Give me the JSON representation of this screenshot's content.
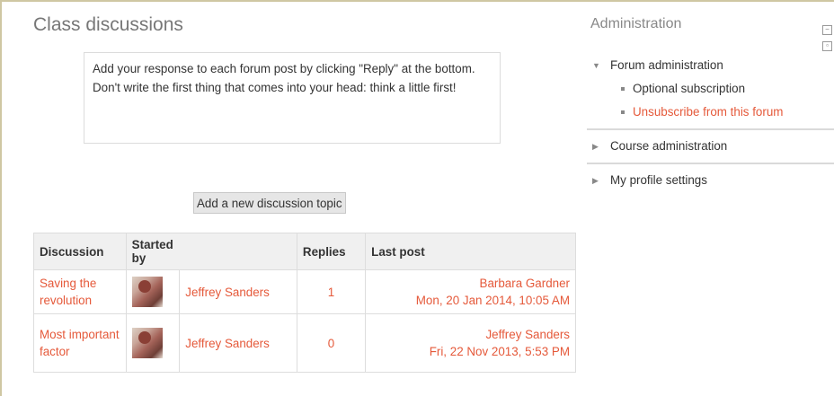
{
  "page": {
    "title": "Class discussions",
    "intro": "Add your response to each forum post by clicking \"Reply\" at the bottom. Don't write the first thing that comes into your head: think a little first!",
    "add_button": "Add a new discussion topic"
  },
  "table": {
    "headers": [
      "Discussion",
      "Started by",
      "Replies",
      "Last post"
    ],
    "rows": [
      {
        "discussion": "Saving the revolution",
        "started_by": "Jeffrey Sanders",
        "replies": "1",
        "last_author": "Barbara Gardner",
        "last_date": "Mon, 20 Jan 2014, 10:05 AM"
      },
      {
        "discussion": "Most important factor",
        "started_by": "Jeffrey Sanders",
        "replies": "0",
        "last_author": "Jeffrey Sanders",
        "last_date": "Fri, 22 Nov 2013, 5:53 PM"
      }
    ]
  },
  "admin": {
    "title": "Administration",
    "forum_admin": "Forum administration",
    "optional_subscription": "Optional subscription",
    "unsubscribe": "Unsubscribe from this forum",
    "course_admin": "Course administration",
    "profile_settings": "My profile settings"
  },
  "colors": {
    "link": "#e5593a",
    "frame": "#cfc7a3"
  }
}
